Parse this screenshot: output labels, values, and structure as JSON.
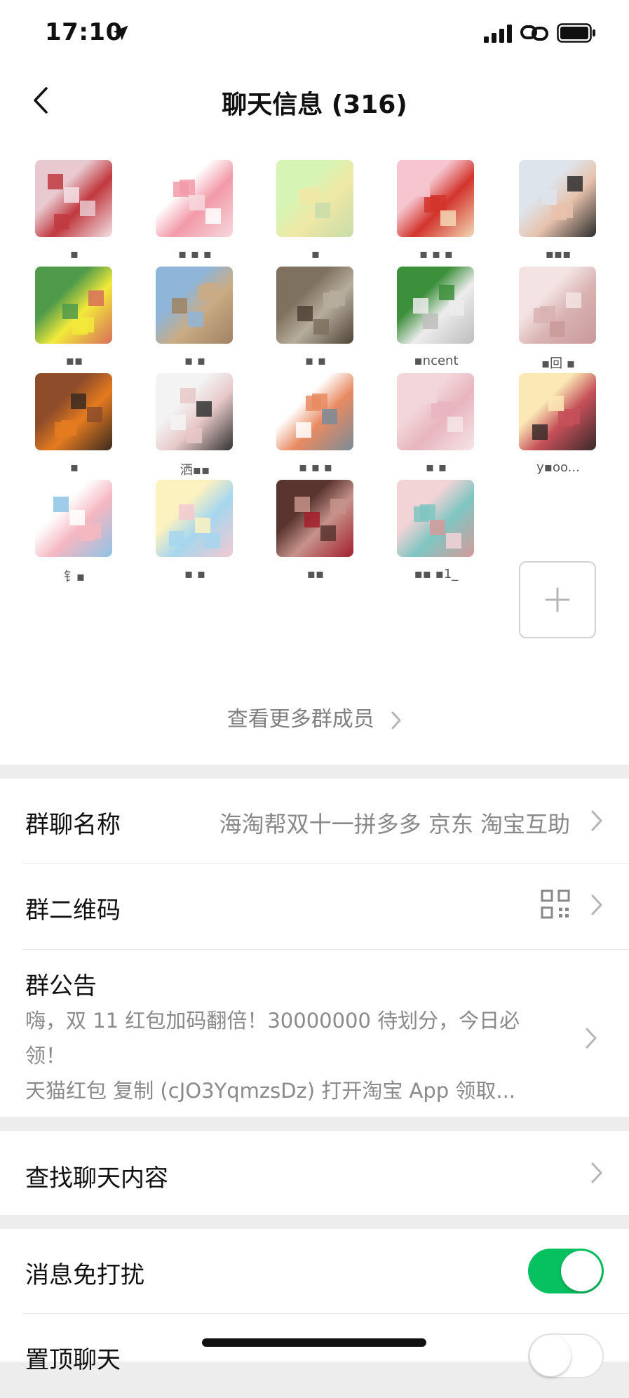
{
  "status_bar": {
    "time": "17:10"
  },
  "nav": {
    "title": "聊天信息 (316)"
  },
  "members": [
    {
      "name": "▪",
      "avatar_colors": [
        "#e8c9cf",
        "#c0393f",
        "#f3e1e4"
      ]
    },
    {
      "name": "▪ ▪ ▪",
      "avatar_colors": [
        "#ffffff",
        "#f29aa8",
        "#f6d8dd"
      ]
    },
    {
      "name": "▪",
      "avatar_colors": [
        "#d6f5b5",
        "#efe8a6",
        "#c9dca8"
      ]
    },
    {
      "name": "▪ ▪ ▪",
      "avatar_colors": [
        "#f6c5cf",
        "#d2342c",
        "#f3d8b5"
      ]
    },
    {
      "name": "▪▪▪",
      "avatar_colors": [
        "#dde4ec",
        "#e7c2ad",
        "#2d2d2d"
      ]
    },
    {
      "name": "▪▪",
      "avatar_colors": [
        "#4f9a4b",
        "#f2ea3a",
        "#d86d5a"
      ]
    },
    {
      "name": "▪ ▪",
      "avatar_colors": [
        "#8fb5d8",
        "#c9ab85",
        "#a08363"
      ]
    },
    {
      "name": "▪ ▪",
      "avatar_colors": [
        "#7f715f",
        "#b7ad9d",
        "#4f4236"
      ]
    },
    {
      "name": "▪ncent",
      "avatar_colors": [
        "#3c8f3b",
        "#ececec",
        "#bdbdbd"
      ]
    },
    {
      "name": "▪回 ▪",
      "avatar_colors": [
        "#f4e3e3",
        "#d9b3b3",
        "#c99999"
      ]
    },
    {
      "name": "▪",
      "avatar_colors": [
        "#8e4c2a",
        "#e57b20",
        "#3a2a20"
      ]
    },
    {
      "name": "洒▪▪",
      "avatar_colors": [
        "#f3f3f3",
        "#e8c8c8",
        "#333333"
      ]
    },
    {
      "name": "▪ ▪ ▪",
      "avatar_colors": [
        "#ffffff",
        "#e88b62",
        "#7a8b98"
      ]
    },
    {
      "name": "▪ ▪",
      "avatar_colors": [
        "#f2d6d9",
        "#e8b5bf",
        "#f5e5e7"
      ]
    },
    {
      "name": "y▪oo...",
      "avatar_colors": [
        "#fbe8b5",
        "#c55059",
        "#3a2a2a"
      ]
    },
    {
      "name": "钅▪",
      "avatar_colors": [
        "#ffffff",
        "#f4b7c1",
        "#8ec3e6"
      ]
    },
    {
      "name": "▪ ▪",
      "avatar_colors": [
        "#fcf2c0",
        "#a6d6ee",
        "#f2c9d0"
      ]
    },
    {
      "name": "▪▪",
      "avatar_colors": [
        "#5a3530",
        "#c6928a",
        "#a21f2d"
      ]
    },
    {
      "name": "▪▪ ▪1_",
      "avatar_colors": [
        "#f2d3d6",
        "#7fc6c2",
        "#d49a9a"
      ]
    }
  ],
  "view_more": "查看更多群成员",
  "settings": {
    "group_name_label": "群聊名称",
    "group_name_value": "海淘帮双十一拼多多 京东 淘宝互助",
    "qr_label": "群二维码",
    "notice_label": "群公告",
    "notice_line1": "嗨，双 11 红包加码翻倍！30000000 待划分，今日必",
    "notice_line2": "领！",
    "notice_line3": "天猫红包 复制 (cJO3YqmzsDz) 打开淘宝 App 领取...",
    "search_label": "查找聊天内容",
    "mute_label": "消息免打扰",
    "mute_on": true,
    "pin_label": "置顶聊天",
    "pin_on": false
  },
  "colors": {
    "accent": "#07c160",
    "background": "#ededed"
  }
}
